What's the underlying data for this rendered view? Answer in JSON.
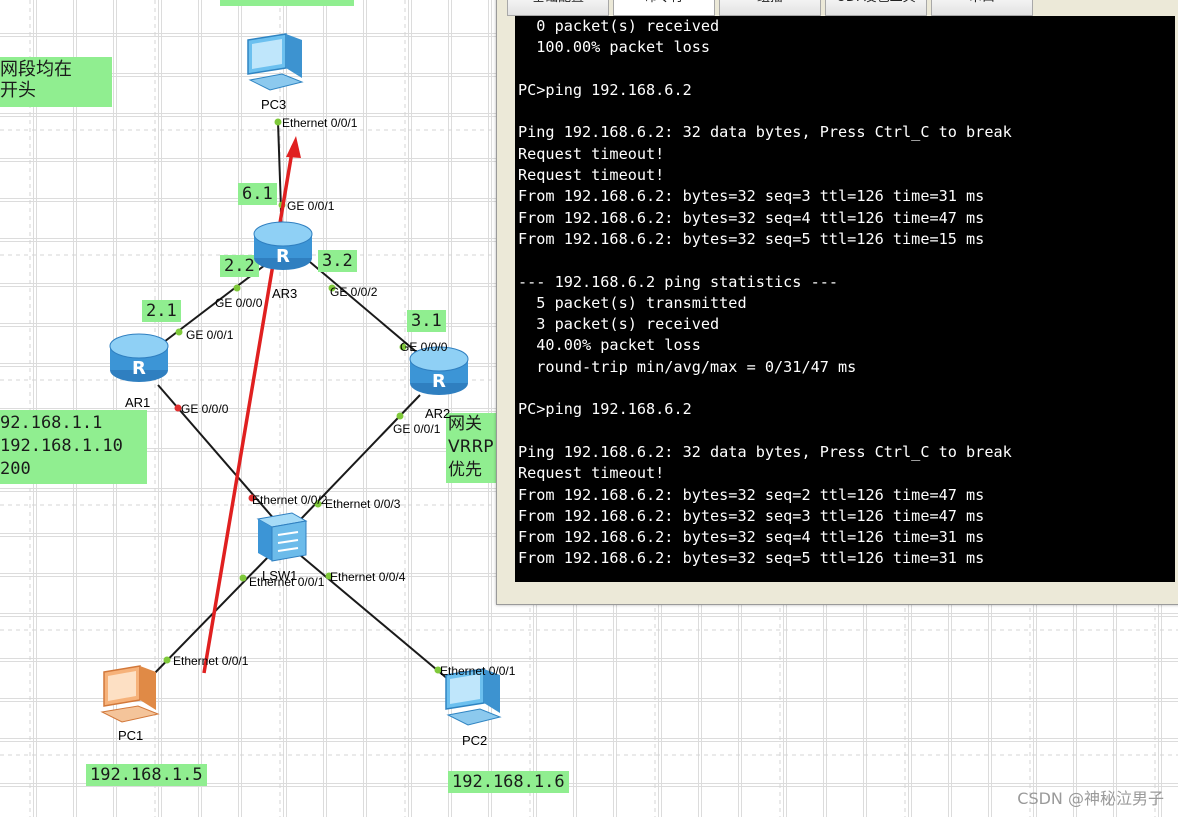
{
  "colors": {
    "link": "#1a1a1a",
    "port_dot": "#7fc93a",
    "port_dot_down": "#e03030",
    "arrow": "#e02020",
    "label_bg": "#90ee90"
  },
  "topology": {
    "top_label": "",
    "note_left": {
      "line1": "网段均在",
      "line2": "开头"
    },
    "note_ar1": {
      "line1": "92.168.1.1",
      "line2": "192.168.1.10",
      "line3": "200"
    },
    "note_ar2": {
      "line1": "网关",
      "line2": "VRRP",
      "line3": "优先"
    },
    "devices": {
      "pc3": {
        "name": "PC3",
        "icon": "pc-icon"
      },
      "ar3": {
        "name": "AR3",
        "icon": "router-icon"
      },
      "ar1": {
        "name": "AR1",
        "icon": "router-icon"
      },
      "ar2": {
        "name": "AR2",
        "icon": "router-icon"
      },
      "lsw1": {
        "name": "LSW1",
        "icon": "switch-icon"
      },
      "pc1": {
        "name": "PC1",
        "icon": "pc-icon"
      },
      "pc2": {
        "name": "PC2",
        "icon": "pc-icon"
      }
    },
    "ip_labels": {
      "l61": "6.1",
      "l22": "2.2",
      "l32": "3.2",
      "l21": "2.1",
      "l31": "3.1",
      "pc1_ip": "192.168.1.5",
      "pc2_ip": "192.168.1.6"
    },
    "ports": {
      "pc3_eth": "Ethernet 0/0/1",
      "ar3_ge001": "GE 0/0/1",
      "ar3_ge000": "GE 0/0/0",
      "ar3_ge002": "GE 0/0/2",
      "ar1_ge001": "GE 0/0/1",
      "ar1_ge000": "GE 0/0/0",
      "ar2_ge000": "GE 0/0/0",
      "ar2_ge001": "GE 0/0/1",
      "lsw_e002": "Ethernet 0/0/2",
      "lsw_e003": "Ethernet 0/0/3",
      "lsw_e001": "Ethernet 0/0/1",
      "lsw_e004": "Ethernet 0/0/4",
      "pc1_eth": "Ethernet 0/0/1",
      "pc2_eth": "Ethernet 0/0/1"
    }
  },
  "terminal_window": {
    "tabs": [
      "基础配置",
      "命令行",
      "组播",
      "UDP发包工具",
      "串口"
    ],
    "lines": [
      "  0 packet(s) received",
      "  100.00% packet loss",
      "",
      "PC>ping 192.168.6.2",
      "",
      "Ping 192.168.6.2: 32 data bytes, Press Ctrl_C to break",
      "Request timeout!",
      "Request timeout!",
      "From 192.168.6.2: bytes=32 seq=3 ttl=126 time=31 ms",
      "From 192.168.6.2: bytes=32 seq=4 ttl=126 time=47 ms",
      "From 192.168.6.2: bytes=32 seq=5 ttl=126 time=15 ms",
      "",
      "--- 192.168.6.2 ping statistics ---",
      "  5 packet(s) transmitted",
      "  3 packet(s) received",
      "  40.00% packet loss",
      "  round-trip min/avg/max = 0/31/47 ms",
      "",
      "PC>ping 192.168.6.2",
      "",
      "Ping 192.168.6.2: 32 data bytes, Press Ctrl_C to break",
      "Request timeout!",
      "From 192.168.6.2: bytes=32 seq=2 ttl=126 time=47 ms",
      "From 192.168.6.2: bytes=32 seq=3 ttl=126 time=47 ms",
      "From 192.168.6.2: bytes=32 seq=4 ttl=126 time=31 ms",
      "From 192.168.6.2: bytes=32 seq=5 ttl=126 time=31 ms"
    ]
  },
  "watermark": "CSDN @神秘泣男子"
}
